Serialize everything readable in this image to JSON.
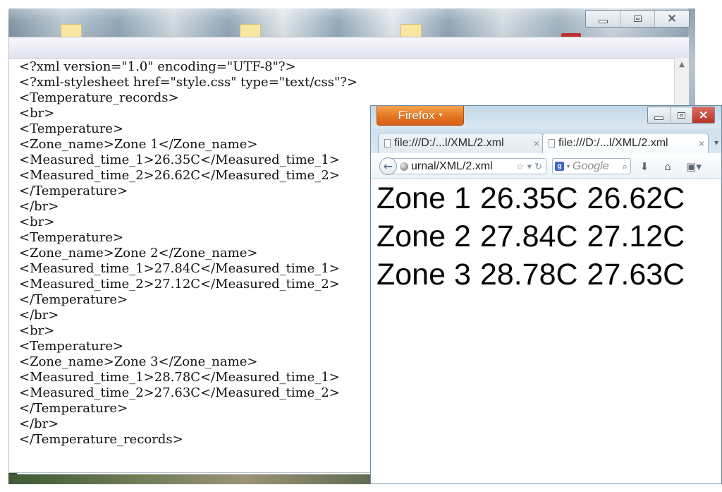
{
  "editor": {
    "lines": [
      "<?xml version=\"1.0\" encoding=\"UTF-8\"?>",
      "<?xml-stylesheet href=\"style.css\" type=\"text/css\"?>",
      "<Temperature_records>",
      "<br>",
      "<Temperature>",
      "<Zone_name>Zone 1</Zone_name>",
      "<Measured_time_1>26.35C</Measured_time_1>",
      "<Measured_time_2>26.62C</Measured_time_2>",
      "</Temperature>",
      "</br>",
      "<br>",
      "<Temperature>",
      "<Zone_name>Zone 2</Zone_name>",
      "<Measured_time_1>27.84C</Measured_time_1>",
      "<Measured_time_2>27.12C</Measured_time_2>",
      "</Temperature>",
      "</br>",
      "<br>",
      "<Temperature>",
      "<Zone_name>Zone 3</Zone_name>",
      "<Measured_time_1>28.78C</Measured_time_1>",
      "<Measured_time_2>27.63C</Measured_time_2>",
      "</Temperature>",
      "</br>",
      "</Temperature_records>"
    ]
  },
  "firefox": {
    "menu_label": "Firefox",
    "tabs": [
      {
        "label": "file:///D:/...l/XML/2.xml"
      },
      {
        "label": "file:///D:/...l/XML/2.xml"
      }
    ],
    "url": "urnal/XML/2.xml",
    "search_placeholder": "Google",
    "content_rows": [
      {
        "zone": "Zone 1",
        "measured_time_1": "26.35C",
        "measured_time_2": "26.62C"
      },
      {
        "zone": "Zone 2",
        "measured_time_1": "27.84C",
        "measured_time_2": "27.12C"
      },
      {
        "zone": "Zone 3",
        "measured_time_1": "28.78C",
        "measured_time_2": "27.63C"
      }
    ]
  },
  "icons": {
    "minimize": "minimize-icon",
    "restore": "restore-icon",
    "close": "close-icon",
    "scroll_up": "scroll-up-icon",
    "back": "back-arrow-icon",
    "globe": "globe-icon",
    "bookmark_star": "bookmark-star-icon",
    "dropdown": "dropdown-arrow-icon",
    "reload": "reload-icon",
    "search_engine": "search-engine-icon",
    "search": "search-icon",
    "download": "download-icon",
    "home": "home-icon",
    "bookmarks": "bookmarks-icon"
  },
  "colors": {
    "firefox_menu": "#e2731f",
    "firefox_chrome": "#c9dbe9",
    "editor_background": "#ffffff",
    "text": "#111111"
  }
}
